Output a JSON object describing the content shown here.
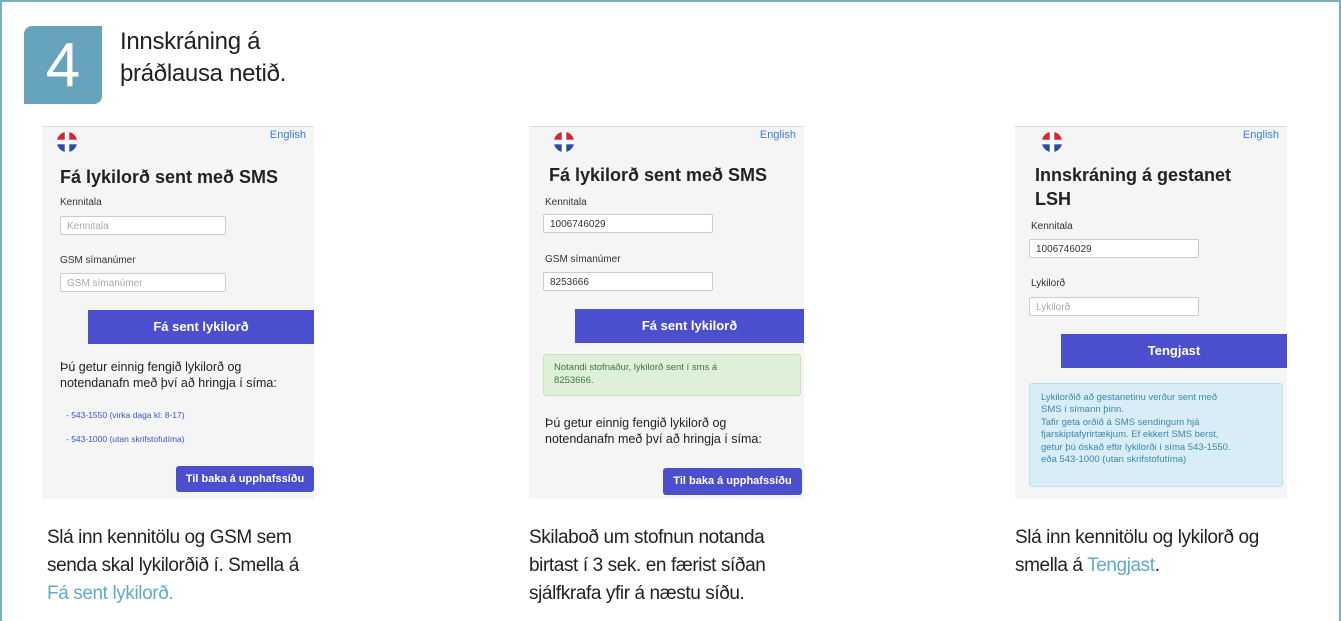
{
  "step": {
    "number": "4",
    "title_line1": "Innskráning á",
    "title_line2": "þráðlausa netið."
  },
  "shot1": {
    "lang_link": "English",
    "title": "Fá lykilorð sent með SMS",
    "kennitala_label": "Kennitala",
    "kennitala_placeholder": "Kennitala",
    "gsm_label": "GSM símanúmer",
    "gsm_placeholder": "GSM símanúmer",
    "submit_label": "Fá sent lykilorð",
    "info_line1": "Þú getur einnig fengið lykilorð og",
    "info_line2": "notendanafn með því að hringja í síma:",
    "phone1": "- 543-1550 (virka daga kl: 8-17)",
    "phone2": "- 543-1000 (utan skrifstofutíma)",
    "back_label": "Til baka á upphafssíðu"
  },
  "shot2": {
    "lang_link": "English",
    "title": "Fá lykilorð sent með SMS",
    "kennitala_label": "Kennitala",
    "kennitala_value": "1006746029",
    "gsm_label": "GSM símanúmer",
    "gsm_value": "8253666",
    "submit_label": "Fá sent lykilorð",
    "success_line1": "Notandi stofnaður, lykilorð sent í sms á",
    "success_line2": "8253666.",
    "info_line1": "Þú getur einnig fengið lykilorð og",
    "info_line2": "notendanafn með því að hringja í síma:",
    "back_label": "Til baka á upphafssíðu"
  },
  "shot3": {
    "lang_link": "English",
    "title_line1": "Innskráning á gestanet",
    "title_line2": "LSH",
    "kennitala_label": "Kennitala",
    "kennitala_value": "1006746029",
    "password_label": "Lykilorð",
    "password_placeholder": "Lykilorð",
    "connect_label": "Tengjast",
    "info_line1": "Lykilorðið að gestanetinu verður sent með",
    "info_line2": "SMS í símann þinn.",
    "info_line3": "Tafir geta orðið á SMS sendingum hjá",
    "info_line4": "fjarskiptafyrirtækjum. Ef ekkert SMS berst,",
    "info_line5": "getur þú óskað eftir lykilorði í síma 543-1550.",
    "info_line6": "eða 543-1000 (utan skrifstofutíma)"
  },
  "captions": {
    "c1_line1": "Slá inn kennitölu og GSM sem",
    "c1_line2": "senda skal lykilorðið í. Smella á",
    "c1_link": "Fá sent lykilorð.",
    "c2_line1": "Skilaboð um stofnun notanda",
    "c2_line2": "birtast í 3 sek. en færist síðan",
    "c2_line3": "sjálfkrafa yfir á næstu síðu.",
    "c3_line1": "Slá inn kennitölu og lykilorð og",
    "c3_line2": "smella á ",
    "c3_link": "Tengjast",
    "c3_end": "."
  },
  "colors": {
    "accent": "#66a3bd",
    "button": "#4b4fce",
    "caption_link": "#63a9c9"
  }
}
